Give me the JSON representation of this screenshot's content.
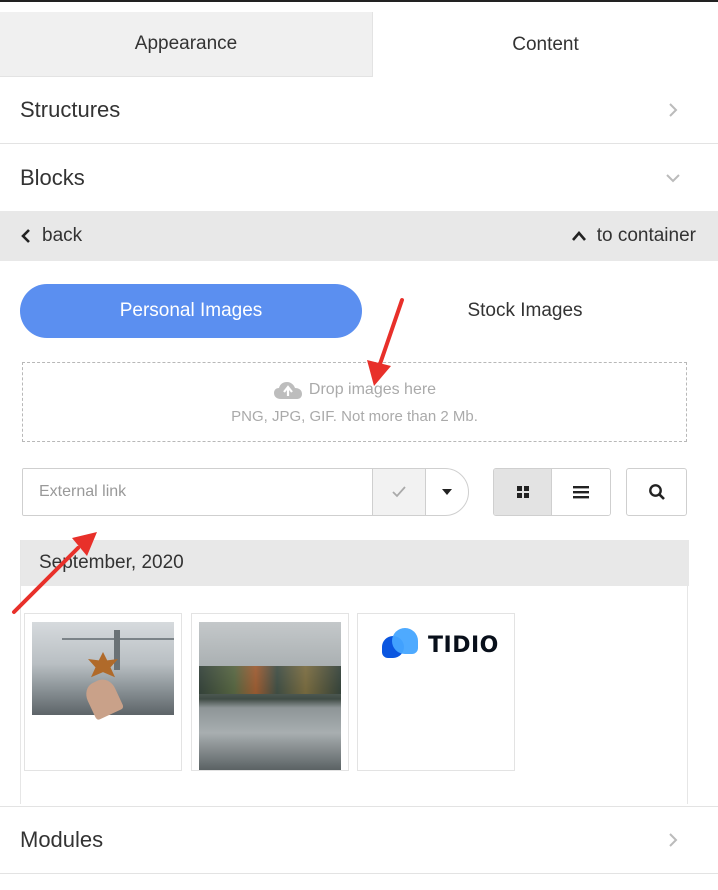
{
  "tabs": {
    "appearance": "Appearance",
    "content": "Content"
  },
  "sections": {
    "structures": "Structures",
    "blocks": "Blocks",
    "modules": "Modules"
  },
  "nav": {
    "back": "back",
    "to_container": "to container"
  },
  "image_tabs": {
    "personal": "Personal Images",
    "stock": "Stock Images",
    "active": "personal"
  },
  "dropzone": {
    "title": "Drop images here",
    "hint": "PNG, JPG, GIF. Not more than 2 Mb."
  },
  "external_link": {
    "placeholder": "External link",
    "value": ""
  },
  "view": {
    "active": "grid"
  },
  "gallery": {
    "group_label": "September, 2020",
    "items": [
      {
        "kind": "photo",
        "subject": "maple leaf in fog"
      },
      {
        "kind": "photo",
        "subject": "misty lake reflection"
      },
      {
        "kind": "logo",
        "text": "TIDIO"
      }
    ]
  },
  "colors": {
    "accent": "#5b8ff0",
    "annotation": "#e8302a",
    "panel_gray": "#e8e8e8"
  },
  "icons": [
    "chevron-right-icon",
    "chevron-down-icon",
    "chevron-left-icon",
    "chevron-up-icon",
    "cloud-upload-icon",
    "check-icon",
    "caret-down-icon",
    "grid-icon",
    "list-icon",
    "search-icon"
  ]
}
